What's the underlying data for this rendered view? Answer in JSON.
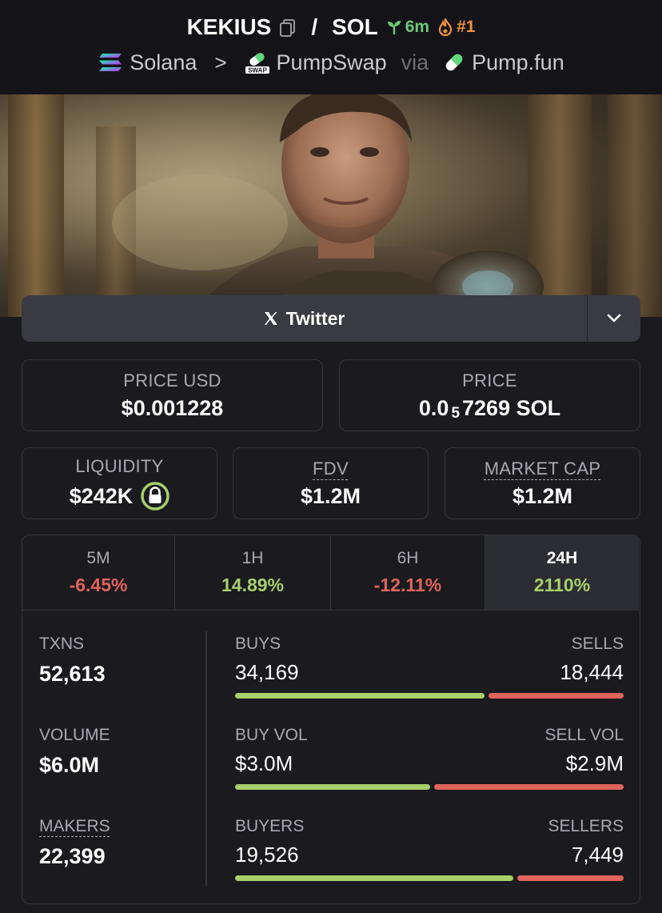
{
  "header": {
    "base_token": "KEKIUS",
    "separator": "/",
    "quote_token": "SOL",
    "age": "6m",
    "rank": "#1",
    "chain": "Solana",
    "dex": "PumpSwap",
    "dex_icon_text": "SWAP",
    "via": "via",
    "launchpad": "Pump.fun",
    "breadcrumb_sep": ">"
  },
  "colors": {
    "positive": "#a8cf6a",
    "negative": "#e0645c",
    "age_green": "#6fc77a",
    "rank_orange": "#f2923a"
  },
  "social": {
    "twitter_label": "Twitter"
  },
  "prices": {
    "price_usd_label": "PRICE USD",
    "price_usd_value": "$0.001228",
    "price_label": "PRICE",
    "price_prefix": "0.0",
    "price_zeros": "5",
    "price_digits": "7269 SOL"
  },
  "metrics": {
    "liquidity_label": "LIQUIDITY",
    "liquidity_value": "$242K",
    "fdv_label": "FDV",
    "fdv_value": "$1.2M",
    "mcap_label": "MARKET CAP",
    "mcap_value": "$1.2M"
  },
  "timeframes": [
    {
      "label": "5M",
      "change": "-6.45%",
      "direction": "neg"
    },
    {
      "label": "1H",
      "change": "14.89%",
      "direction": "pos"
    },
    {
      "label": "6H",
      "change": "-12.11%",
      "direction": "neg"
    },
    {
      "label": "24H",
      "change": "2110%",
      "direction": "pos",
      "active": true
    }
  ],
  "stats": {
    "txns_label": "TXNS",
    "txns_value": "52,613",
    "volume_label": "VOLUME",
    "volume_value": "$6.0M",
    "makers_label": "MAKERS",
    "makers_value": "22,399",
    "buys_label": "BUYS",
    "buys_value": "34,169",
    "sells_label": "SELLS",
    "sells_value": "18,444",
    "buys_share": 0.649,
    "buy_vol_label": "BUY VOL",
    "buy_vol_value": "$3.0M",
    "sell_vol_label": "SELL VOL",
    "sell_vol_value": "$2.9M",
    "buy_vol_share": 0.508,
    "buyers_label": "BUYERS",
    "buyers_value": "19,526",
    "sellers_label": "SELLERS",
    "sellers_value": "7,449",
    "buyers_share": 0.724
  }
}
